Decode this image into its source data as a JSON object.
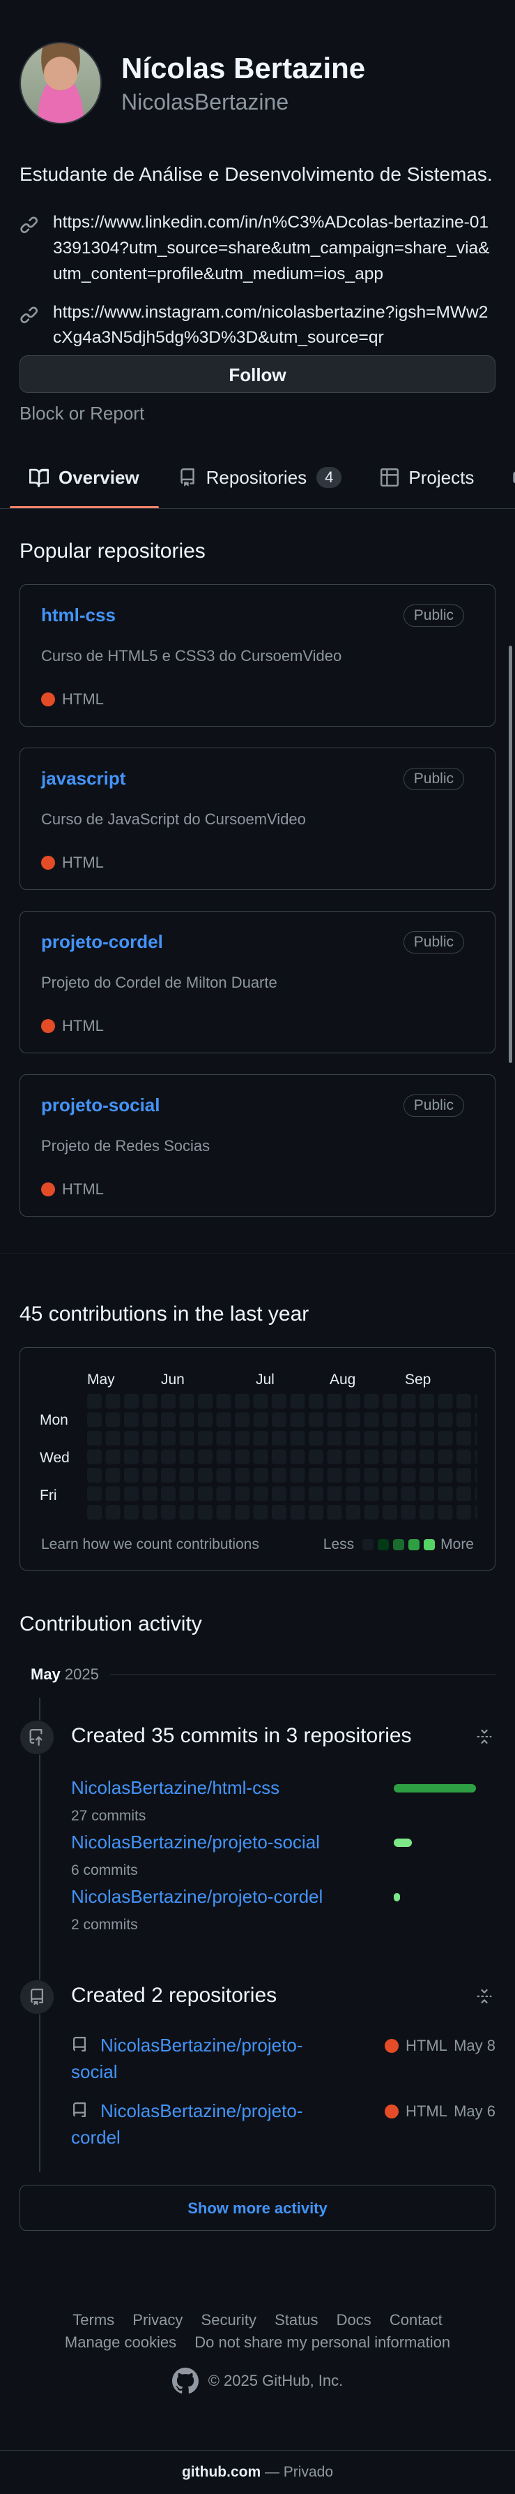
{
  "profile": {
    "full_name": "Nícolas Bertazine",
    "username": "NicolasBertazine",
    "bio": "Estudante de Análise e Desenvolvimento de Sistemas.",
    "links": [
      "https://www.linkedin.com/in/n%C3%ADcolas-bertazine-013391304?utm_source=share&utm_campaign=share_via&utm_content=profile&utm_medium=ios_app",
      "https://www.instagram.com/nicolasbertazine?igsh=MWw2cXg4a3N5djh5dg%3D%3D&utm_source=qr"
    ],
    "follow_label": "Follow",
    "block_report_label": "Block or Report"
  },
  "tabs": [
    {
      "label": "Overview",
      "icon": "book-icon",
      "active": true
    },
    {
      "label": "Repositories",
      "icon": "repo-icon",
      "count": "4"
    },
    {
      "label": "Projects",
      "icon": "table-icon"
    },
    {
      "label": "",
      "icon": "package-icon"
    }
  ],
  "popular": {
    "title": "Popular repositories",
    "repos": [
      {
        "name": "html-css",
        "visibility": "Public",
        "description": "Curso de HTML5 e CSS3 do CursoemVideo",
        "language": "HTML",
        "lang_color": "#e34c26"
      },
      {
        "name": "javascript",
        "visibility": "Public",
        "description": "Curso de JavaScript do CursoemVideo",
        "language": "HTML",
        "lang_color": "#e34c26"
      },
      {
        "name": "projeto-cordel",
        "visibility": "Public",
        "description": "Projeto do Cordel de Milton Duarte",
        "language": "HTML",
        "lang_color": "#e34c26"
      },
      {
        "name": "projeto-social",
        "visibility": "Public",
        "description": "Projeto de Redes Socias",
        "language": "HTML",
        "lang_color": "#e34c26"
      }
    ]
  },
  "contributions": {
    "title": "45 contributions in the last year",
    "months": [
      "May",
      "Jun",
      "Jul",
      "Aug",
      "Sep"
    ],
    "days": [
      "Mon",
      "Wed",
      "Fri"
    ],
    "learn_label": "Learn how we count contributions",
    "less_label": "Less",
    "more_label": "More",
    "level_colors": [
      "#151b23",
      "#033a16",
      "#196c2e",
      "#2ea043",
      "#56d364"
    ]
  },
  "activity": {
    "title": "Contribution activity",
    "period_month": "May",
    "period_year": "2025",
    "commits_event": {
      "title": "Created 35 commits in 3 repositories",
      "items": [
        {
          "repo": "NicolasBertazine/html-css",
          "count_label": "27 commits",
          "commits": 27,
          "bar_color": "#2ea043"
        },
        {
          "repo": "NicolasBertazine/projeto-social",
          "count_label": "6 commits",
          "commits": 6,
          "bar_color": "#7ee787"
        },
        {
          "repo": "NicolasBertazine/projeto-cordel",
          "count_label": "2 commits",
          "commits": 2,
          "bar_color": "#7ee787"
        }
      ]
    },
    "repos_event": {
      "title": "Created 2 repositories",
      "items": [
        {
          "repo": "NicolasBertazine/projeto-social",
          "language": "HTML",
          "lang_color": "#e34c26",
          "date": "May 8"
        },
        {
          "repo": "NicolasBertazine/projeto-cordel",
          "language": "HTML",
          "lang_color": "#e34c26",
          "date": "May 6"
        }
      ]
    },
    "show_more_label": "Show more activity"
  },
  "footer": {
    "links_row1": [
      "Terms",
      "Privacy",
      "Security",
      "Status",
      "Docs",
      "Contact"
    ],
    "links_row2": [
      "Manage cookies",
      "Do not share my personal information"
    ],
    "copyright": "© 2025 GitHub, Inc."
  },
  "browser_bar": {
    "domain": "github.com",
    "mode": "— Privado"
  }
}
